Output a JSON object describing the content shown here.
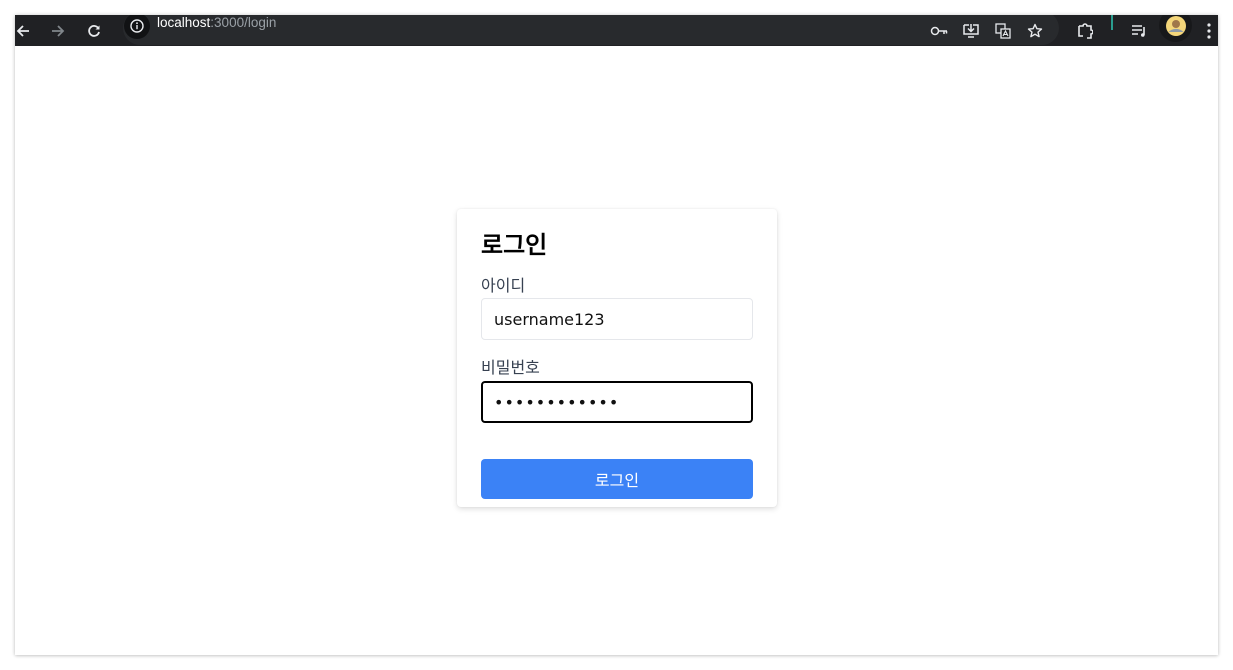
{
  "browser": {
    "url_host": "localhost",
    "url_rest": ":3000/login",
    "icons": [
      "back-icon",
      "forward-icon",
      "reload-icon",
      "site-info-icon",
      "key-icon",
      "install-app-icon",
      "translate-icon",
      "bookmark-star-icon",
      "extensions-icon",
      "reading-list-icon",
      "profile-avatar",
      "menu-icon"
    ],
    "colors": {
      "toolbar": "#202124",
      "accent_divider": "#2a9d8f"
    }
  },
  "login": {
    "title": "로그인",
    "username_label": "아이디",
    "username_value": "username123",
    "password_label": "비밀번호",
    "password_value": "••••••••••••",
    "submit_label": "로그인",
    "colors": {
      "button": "#3b82f6",
      "button_text": "#ffffff"
    }
  }
}
